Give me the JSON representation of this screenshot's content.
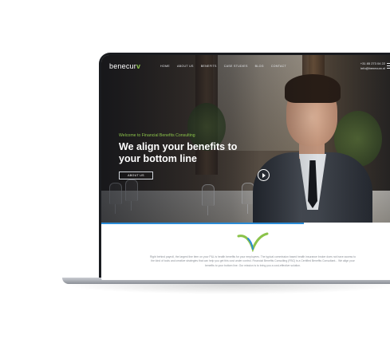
{
  "site": {
    "logo_text": "benecur",
    "logo_mark": "v",
    "nav": [
      "HOME",
      "ABOUT US",
      "BENEFITS",
      "CASE STUDIES",
      "BLOG",
      "CONTACT"
    ],
    "phone": "+31 85 273 04 22",
    "email": "info@benecurv.nl"
  },
  "hero": {
    "welcome": "Welcome to Financial Benefits Consulting",
    "headline_line1": "We align your benefits to",
    "headline_line2": "your bottom line",
    "button": "ABOUT US"
  },
  "intro": {
    "text": "Right behind payroll, the largest line item on your P&L is health benefits for your employees. The typical commission based health insurance broker does not have access to the kind of tools and creative strategies that can help you get this cost under control. Financial Benefits Consulting (FBC) is a Certified Benefits Consultant... We align your benefits to your bottom line. Our mission is to bring you a cost-effective solution."
  },
  "colors": {
    "accent_green": "#8bc34a",
    "accent_blue": "#2a8bd6",
    "laptop_frame": "#1a1c20"
  }
}
